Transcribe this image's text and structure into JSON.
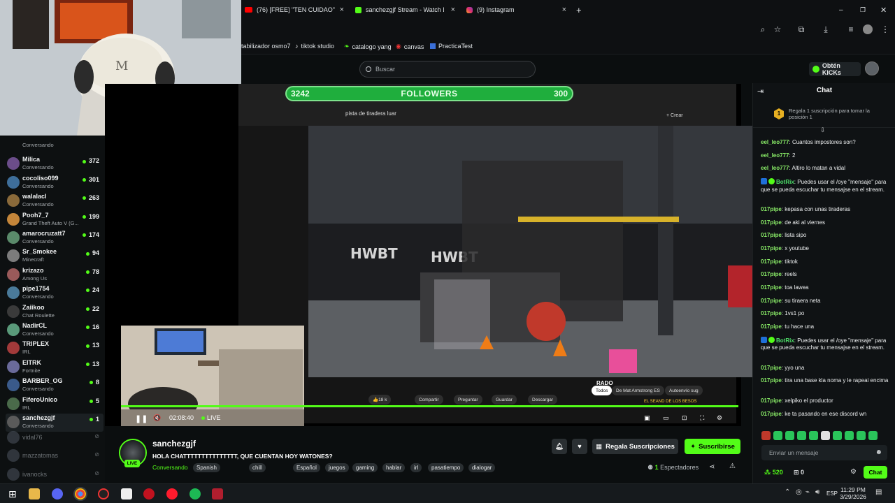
{
  "browser": {
    "tabs": [
      {
        "label": "(76) [FREE] \"TEN CUIDAO\" [",
        "icon": "youtube-icon"
      },
      {
        "label": "sanchezgjf Stream - Watch Live",
        "icon": "kick-icon"
      },
      {
        "label": "(9) Instagram",
        "icon": "instagram-icon"
      }
    ],
    "new_tab": "+",
    "bookmarks": [
      "tabilizador osmo7",
      "tiktok studio",
      "catalogo yang",
      "canvas",
      "PracticaTest"
    ]
  },
  "header": {
    "search_placeholder": "Buscar",
    "kicks_label": "Obtén KICKs"
  },
  "sidebar": {
    "channels": [
      {
        "name": "",
        "sub": "Conversando",
        "count": ""
      },
      {
        "name": "Milica",
        "sub": "Conversando",
        "count": "372"
      },
      {
        "name": "cocoliso099",
        "sub": "Conversando",
        "count": "301"
      },
      {
        "name": "walalacl",
        "sub": "Conversando",
        "count": "263"
      },
      {
        "name": "Pooh7_7",
        "sub": "Grand Theft Auto V (G...",
        "count": "199"
      },
      {
        "name": "amarocruzatt7",
        "sub": "Conversando",
        "count": "174"
      },
      {
        "name": "Sr_Smokee",
        "sub": "Minecraft",
        "count": "94"
      },
      {
        "name": "krizazo",
        "sub": "Among Us",
        "count": "78"
      },
      {
        "name": "pipe1754",
        "sub": "Conversando",
        "count": "24"
      },
      {
        "name": "Zaiikoo",
        "sub": "Chat Roulette",
        "count": "22"
      },
      {
        "name": "NadirCL",
        "sub": "Conversando",
        "count": "16"
      },
      {
        "name": "TRIPLEX",
        "sub": "IRL",
        "count": "13"
      },
      {
        "name": "EITRK",
        "sub": "Fortnite",
        "count": "13"
      },
      {
        "name": "BARBER_OG",
        "sub": "Conversando",
        "count": "8"
      },
      {
        "name": "FiferoUnico",
        "sub": "IRL",
        "count": "5"
      },
      {
        "name": "sanchezgjf",
        "sub": "Conversando",
        "count": "1"
      }
    ],
    "offline": [
      "vidal76",
      "mazzatomas",
      "ivanocks"
    ]
  },
  "player": {
    "followers_label": "FOLLOWERS",
    "followers_current": "3242",
    "followers_goal": "300",
    "time": "02:08:40",
    "live_label": "LIVE",
    "yt_search": "pista de tiradera luar",
    "yt_create": "Crear",
    "yt_like": "18 k",
    "yt_share": "Compartir",
    "yt_ask": "Preguntar",
    "yt_save": "Guardar",
    "yt_download": "Descargar",
    "yt_chips": [
      "Todos",
      "De Mat Armstrong ES",
      "Autoenvío sug"
    ],
    "yt_title_fragment": "RADO",
    "yt_related": "EL SEAND DE LOS BESOS"
  },
  "stream": {
    "channel": "sanchezgjf",
    "live_badge": "LIVE",
    "title": "HOLA CHATTTTTTTTTTTTTTT, QUE CUENTAN HOY WATONES?",
    "category": "Conversando",
    "tags": [
      "Spanish",
      "chill",
      "Español",
      "juegos",
      "gaming",
      "hablar",
      "irl",
      "pasatiempo",
      "dialogar"
    ],
    "gift_label": "Regala Suscripciones",
    "subscribe_label": "Suscribirse",
    "viewers_count": "1",
    "viewers_label": "Espectadores"
  },
  "chat": {
    "title": "Chat",
    "gift_rank": "1",
    "gift_text": "Regala 1 suscripción para tomar la posición 1",
    "messages": [
      {
        "user": "eel_leo777",
        "text": "Cuantos impostores son?"
      },
      {
        "user": "eel_leo777",
        "text": "2"
      },
      {
        "user": "eel_leo777",
        "text": "Altiro lo matan a vidal"
      },
      {
        "user": "BotRix",
        "text": "Puedes usar el /oye \"mensaje\" para que se pueda escuchar tu mensajse en el stream.",
        "bot": true
      },
      {
        "user": "017pipe",
        "text": "kepasa con unas tiraderas"
      },
      {
        "user": "017pipe",
        "text": "de aki al viernes"
      },
      {
        "user": "017pipe",
        "text": "lista sipo"
      },
      {
        "user": "017pipe",
        "text": "x youtube"
      },
      {
        "user": "017pipe",
        "text": "tiktok"
      },
      {
        "user": "017pipe",
        "text": "reels"
      },
      {
        "user": "017pipe",
        "text": "toa lawea"
      },
      {
        "user": "017pipe",
        "text": "su tiraera neta"
      },
      {
        "user": "017pipe",
        "text": "1vs1 po"
      },
      {
        "user": "017pipe",
        "text": "tu hace una"
      },
      {
        "user": "BotRix",
        "text": "Puedes usar el /oye \"mensaje\" para que se pueda escuchar tu mensajse en el stream.",
        "bot": true
      },
      {
        "user": "017pipe",
        "text": "yyo una"
      },
      {
        "user": "017pipe",
        "text": "tira una base kla noma y le rapeai encima"
      },
      {
        "user": "017pipe",
        "text": "xelpiko el productor"
      },
      {
        "user": "017pipe",
        "text": "ke ta pasando en ese discord wn"
      }
    ],
    "input_placeholder": "Enviar un mensaje",
    "points": "520",
    "slots": "0",
    "send_label": "Chat"
  },
  "taskbar": {
    "lang": "ESP",
    "time": "11:29 PM",
    "date": "3/29/2026"
  },
  "colors": {
    "accent": "#53fc18",
    "background": "#0b0e0f",
    "followers_bar": "#1fae3d"
  }
}
